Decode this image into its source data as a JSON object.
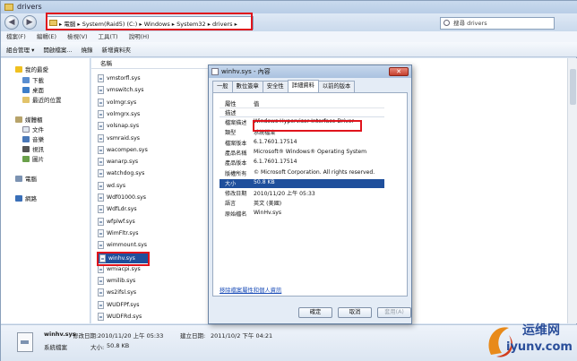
{
  "window": {
    "title": "drivers"
  },
  "address": {
    "path": "▸ 電腦 ▸ System(Raid5) (C:) ▸ Windows ▸ System32 ▸ drivers ▸",
    "search_placeholder": "搜尋 drivers"
  },
  "menu": [
    "檔案(F)",
    "編輯(E)",
    "檢視(V)",
    "工具(T)",
    "說明(H)"
  ],
  "toolbar": [
    "組合管理 ▾",
    "開啟檔案...",
    "燒錄",
    "新增資料夾"
  ],
  "navpane": {
    "favorites": "我的最愛",
    "downloads": "下載",
    "desktop": "桌面",
    "recent": "最近的位置",
    "libraries": "媒體櫃",
    "documents": "文件",
    "music": "音樂",
    "videos": "視訊",
    "pictures": "圖片",
    "computer": "電腦",
    "network": "網路"
  },
  "filelist": {
    "column_name": "名稱",
    "files": [
      "vmstorfl.sys",
      "vmswitch.sys",
      "volmgr.sys",
      "volmgrx.sys",
      "volsnap.sys",
      "vsmraid.sys",
      "wacompen.sys",
      "wanarp.sys",
      "watchdog.sys",
      "wd.sys",
      "Wdf01000.sys",
      "WdfLdr.sys",
      "wfplwf.sys",
      "WimFltr.sys",
      "wimmount.sys",
      "winhv.sys",
      "wmiacpi.sys",
      "wmilib.sys",
      "ws2ifsl.sys",
      "WUDFPf.sys",
      "WUDFRd.sys"
    ],
    "selected": "winhv.sys"
  },
  "details": {
    "filename": "winhv.sys",
    "type": "系統檔案",
    "modified_label": "修改日期:",
    "modified": "2010/11/20 上午 05:33",
    "created_label": "建立日期:",
    "created": "2011/10/2 下午 04:21",
    "size_label": "大小:",
    "size": "50.8 KB"
  },
  "dialog": {
    "title": "winhv.sys - 內容",
    "tabs": [
      "一般",
      "數位簽章",
      "安全性",
      "詳細資料",
      "以前的版本"
    ],
    "active_tab": "詳細資料",
    "col_property": "屬性",
    "col_value": "值",
    "group": "描述",
    "properties": [
      {
        "k": "檔案描述",
        "v": "Windows Hypervisor Interface Driver"
      },
      {
        "k": "類型",
        "v": "系統檔案"
      },
      {
        "k": "檔案版本",
        "v": "6.1.7601.17514"
      },
      {
        "k": "產品名稱",
        "v": "Microsoft® Windows® Operating System"
      },
      {
        "k": "產品版本",
        "v": "6.1.7601.17514"
      },
      {
        "k": "版權所有",
        "v": "© Microsoft Corporation. All rights reserved."
      },
      {
        "k": "大小",
        "v": "50.8 KB"
      },
      {
        "k": "修改日期",
        "v": "2010/11/20 上午 05:33"
      },
      {
        "k": "語言",
        "v": "英文 (美國)"
      },
      {
        "k": "原始檔名",
        "v": "WinHv.sys"
      }
    ],
    "link": "移除檔案屬性和個人資訊",
    "ok": "確定",
    "cancel": "取消",
    "apply": "套用(A)"
  },
  "watermark": {
    "text": "运维网",
    "url": "iyunv.com"
  },
  "colors": {
    "selection": "#1f4f9c",
    "highlight_box": "#e0141c",
    "link": "#1a4db8"
  }
}
